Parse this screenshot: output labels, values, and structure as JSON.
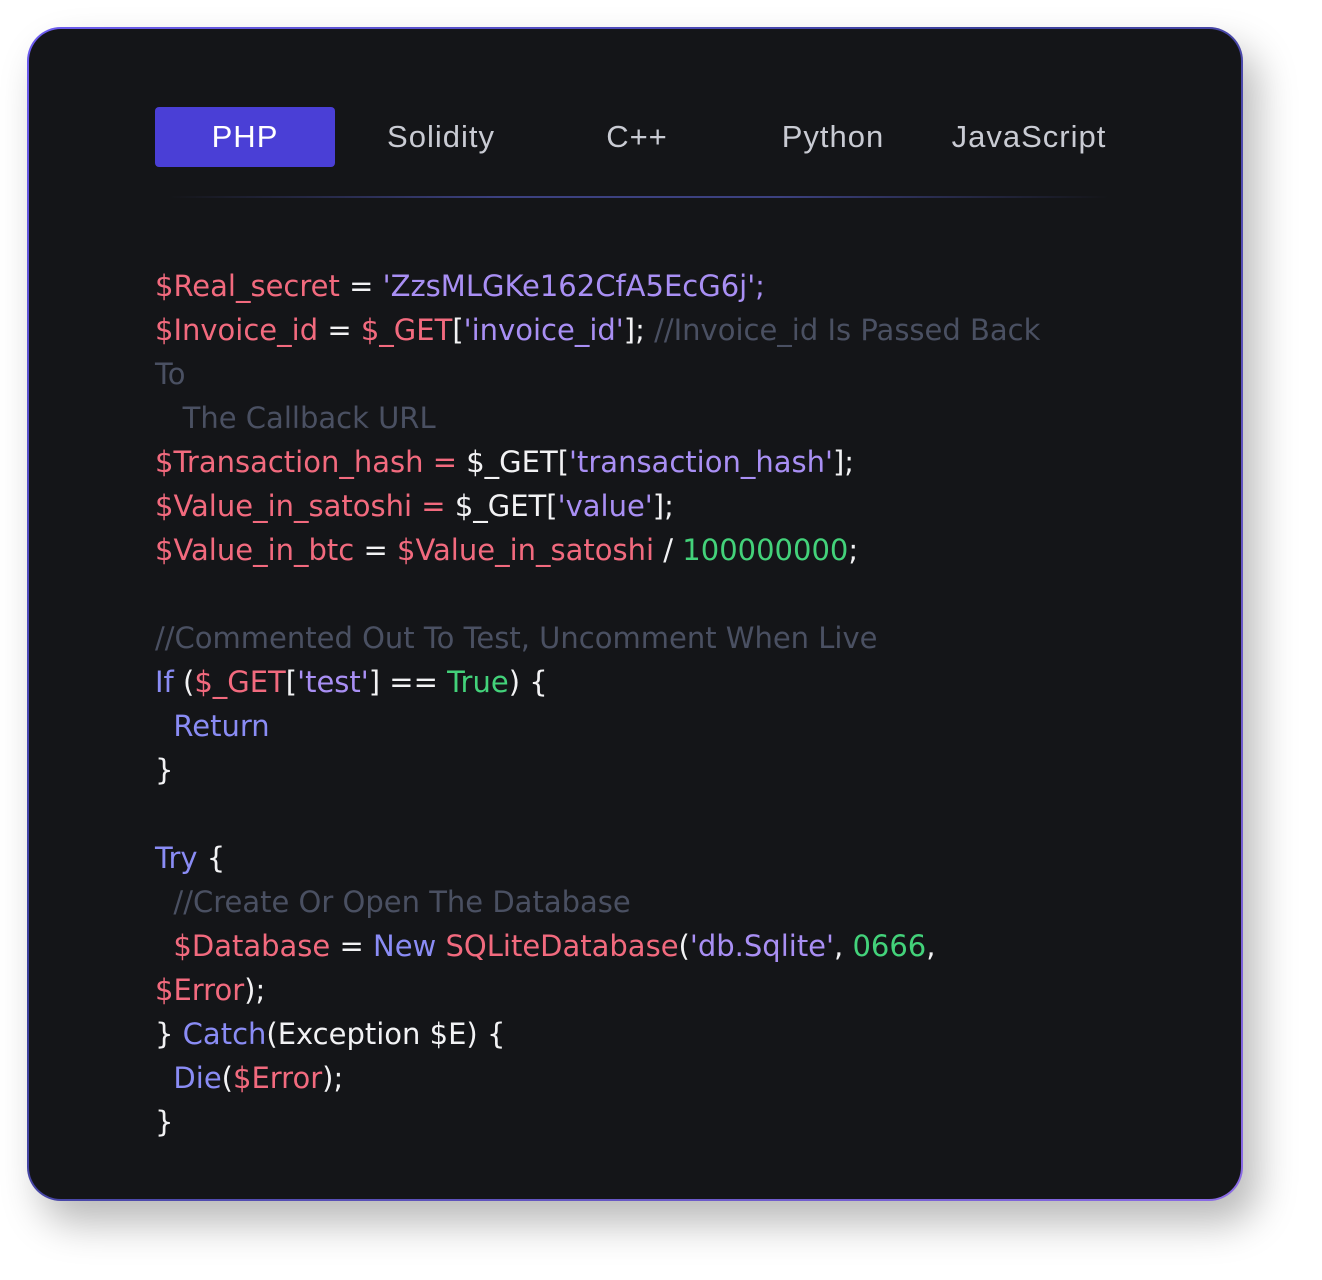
{
  "tabs": [
    {
      "label": "PHP",
      "active": true
    },
    {
      "label": "Solidity",
      "active": false
    },
    {
      "label": "C++",
      "active": false
    },
    {
      "label": "Python",
      "active": false
    },
    {
      "label": "JavaScript",
      "active": false
    }
  ],
  "colors": {
    "background": "#141518",
    "active_tab": "#4a3fd6",
    "variable": "#f26a7e",
    "string": "#a98ff4",
    "comment": "#4a5062",
    "keyword": "#8a8cf5",
    "number": "#43d27a",
    "plain": "#f2f2f4"
  },
  "code_lines": [
    [
      [
        "v",
        "$Real_secret"
      ],
      [
        "p",
        " = "
      ],
      [
        "s",
        "'ZzsMLGKe162CfA5EcG6j';"
      ]
    ],
    [
      [
        "v",
        "$Invoice_id"
      ],
      [
        "p",
        " = "
      ],
      [
        "v",
        "$_GET"
      ],
      [
        "p",
        "["
      ],
      [
        "s",
        "'invoice_id'"
      ],
      [
        "p",
        "]; "
      ],
      [
        "c",
        "//Invoice_id Is Passed Back"
      ]
    ],
    [
      [
        "c",
        "To"
      ]
    ],
    [
      [
        "c",
        "   The Callback URL"
      ]
    ],
    [
      [
        "v",
        "$Transaction_hash = "
      ],
      [
        "p",
        "$_GET"
      ],
      [
        "p",
        "["
      ],
      [
        "s",
        "'transaction_hash'"
      ],
      [
        "p",
        "];"
      ]
    ],
    [
      [
        "v",
        "$Value_in_satoshi = "
      ],
      [
        "p",
        "$_GET"
      ],
      [
        "p",
        "["
      ],
      [
        "s",
        "'value'"
      ],
      [
        "p",
        "];"
      ]
    ],
    [
      [
        "v",
        "$Value_in_btc"
      ],
      [
        "p",
        " = "
      ],
      [
        "v",
        "$Value_in_satoshi"
      ],
      [
        "p",
        " / "
      ],
      [
        "n",
        "100000000"
      ],
      [
        "p",
        ";"
      ]
    ],
    [],
    [
      [
        "c",
        "//Commented Out To Test, Uncomment When Live"
      ]
    ],
    [
      [
        "k",
        "If"
      ],
      [
        "p",
        " ("
      ],
      [
        "v",
        "$_GET"
      ],
      [
        "p",
        "["
      ],
      [
        "s",
        "'test'"
      ],
      [
        "p",
        "] == "
      ],
      [
        "n",
        "True"
      ],
      [
        "p",
        ") {"
      ]
    ],
    [
      [
        "k",
        "  Return"
      ]
    ],
    [
      [
        "p",
        "}"
      ]
    ],
    [],
    [
      [
        "k",
        "Try"
      ],
      [
        "p",
        " {"
      ]
    ],
    [
      [
        "c",
        "  //Create Or Open The Database"
      ]
    ],
    [
      [
        "v",
        "  $Database"
      ],
      [
        "p",
        " = "
      ],
      [
        "k",
        "New"
      ],
      [
        "p",
        " "
      ],
      [
        "v",
        "SQLiteDatabase"
      ],
      [
        "p",
        "("
      ],
      [
        "s",
        "'db.Sqlite'"
      ],
      [
        "p",
        ", "
      ],
      [
        "n",
        "0666"
      ],
      [
        "p",
        ","
      ]
    ],
    [
      [
        "v",
        "$Error"
      ],
      [
        "p",
        ");"
      ]
    ],
    [
      [
        "p",
        "} "
      ],
      [
        "k",
        "Catch"
      ],
      [
        "p",
        "(Exception $E) {"
      ]
    ],
    [
      [
        "k",
        "  Die"
      ],
      [
        "p",
        "("
      ],
      [
        "v",
        "$Error"
      ],
      [
        "p",
        ");"
      ]
    ],
    [
      [
        "p",
        "}"
      ]
    ]
  ]
}
